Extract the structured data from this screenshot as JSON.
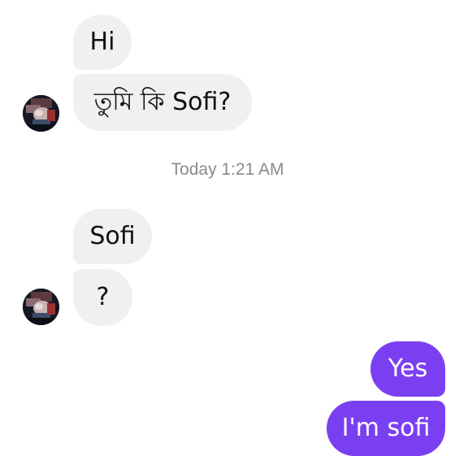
{
  "conversation": {
    "timestamp": "Today 1:21 AM",
    "messages": [
      {
        "from": "them",
        "text": "Hi"
      },
      {
        "from": "them",
        "text": "তুমি কি Sofi?"
      },
      {
        "from": "them",
        "text": "Sofi"
      },
      {
        "from": "them",
        "text": "?"
      },
      {
        "from": "me",
        "text": "Yes"
      },
      {
        "from": "me",
        "text": "I'm sofi"
      }
    ]
  },
  "colors": {
    "incoming_bubble": "#f0f0f0",
    "outgoing_bubble": "#7b3ff2",
    "timestamp_text": "#8a8a8a"
  },
  "icons": {
    "avatar": "contact-avatar-photo"
  }
}
